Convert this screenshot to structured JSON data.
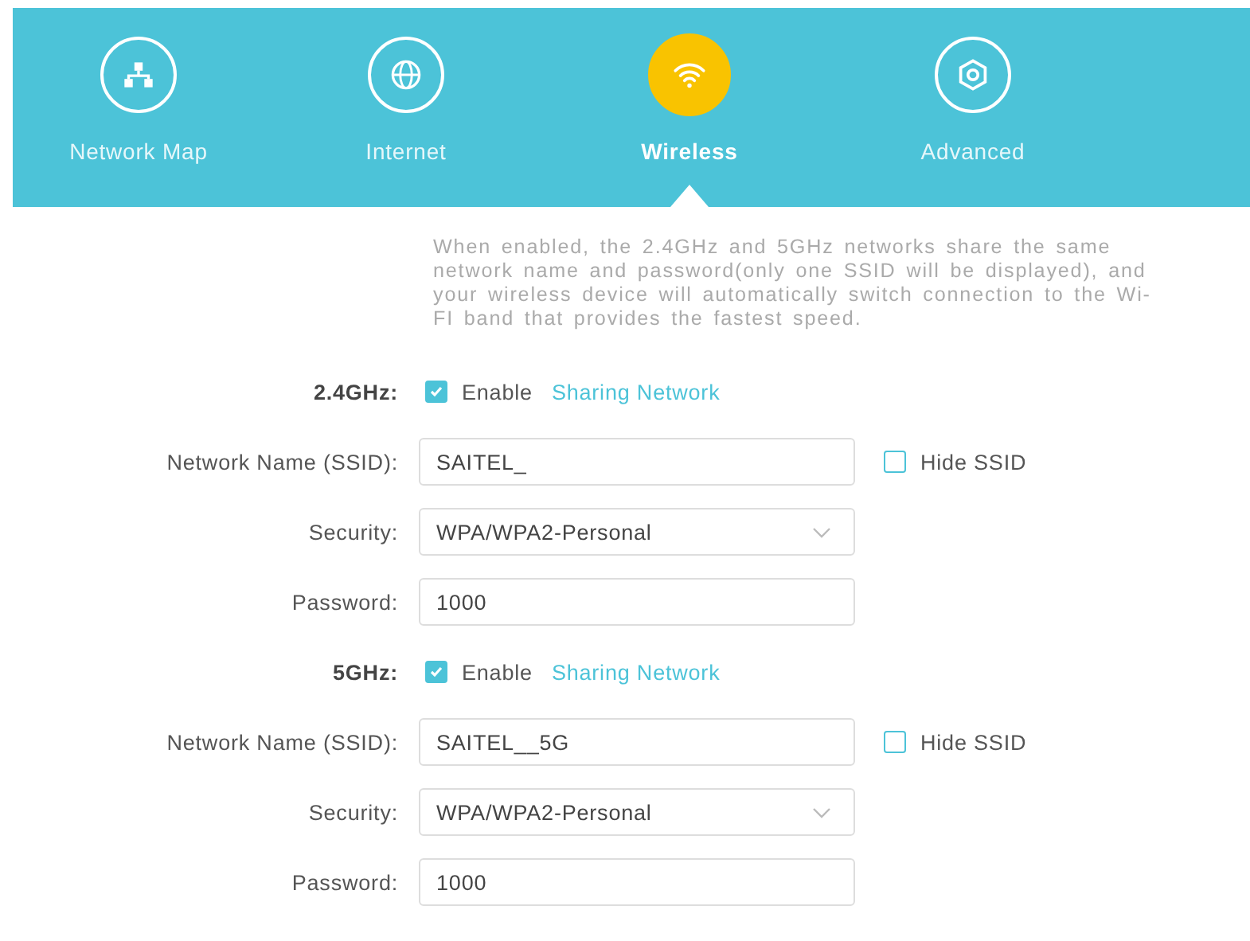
{
  "tabs": [
    {
      "label": "Network Map",
      "selected": false
    },
    {
      "label": "Internet",
      "selected": false
    },
    {
      "label": "Wireless",
      "selected": true
    },
    {
      "label": "Advanced",
      "selected": false
    }
  ],
  "description": "When enabled, the 2.4GHz and 5GHz networks share the same network name and password(only one SSID will be displayed), and your wireless device will automatically switch connection to the Wi-FI band that provides the fastest speed.",
  "bands": [
    {
      "label": "2.4GHz:",
      "enable": {
        "label": "Enable",
        "checked": true
      },
      "link": "Sharing Network",
      "fields": [
        {
          "kind": "text",
          "label": "Network Name (SSID):",
          "value": "SAITEL_",
          "option": {
            "label": "Hide SSID",
            "checked": false
          }
        },
        {
          "kind": "select",
          "label": "Security:",
          "value": "WPA/WPA2-Personal"
        },
        {
          "kind": "text",
          "label": "Password:",
          "value": "1000"
        }
      ]
    },
    {
      "label": "5GHz:",
      "enable": {
        "label": "Enable",
        "checked": true
      },
      "link": "Sharing Network",
      "fields": [
        {
          "kind": "text",
          "label": "Network Name (SSID):",
          "value": "SAITEL__5G",
          "option": {
            "label": "Hide SSID",
            "checked": false
          }
        },
        {
          "kind": "select",
          "label": "Security:",
          "value": "WPA/WPA2-Personal"
        },
        {
          "kind": "text",
          "label": "Password:",
          "value": "1000"
        }
      ]
    }
  ]
}
